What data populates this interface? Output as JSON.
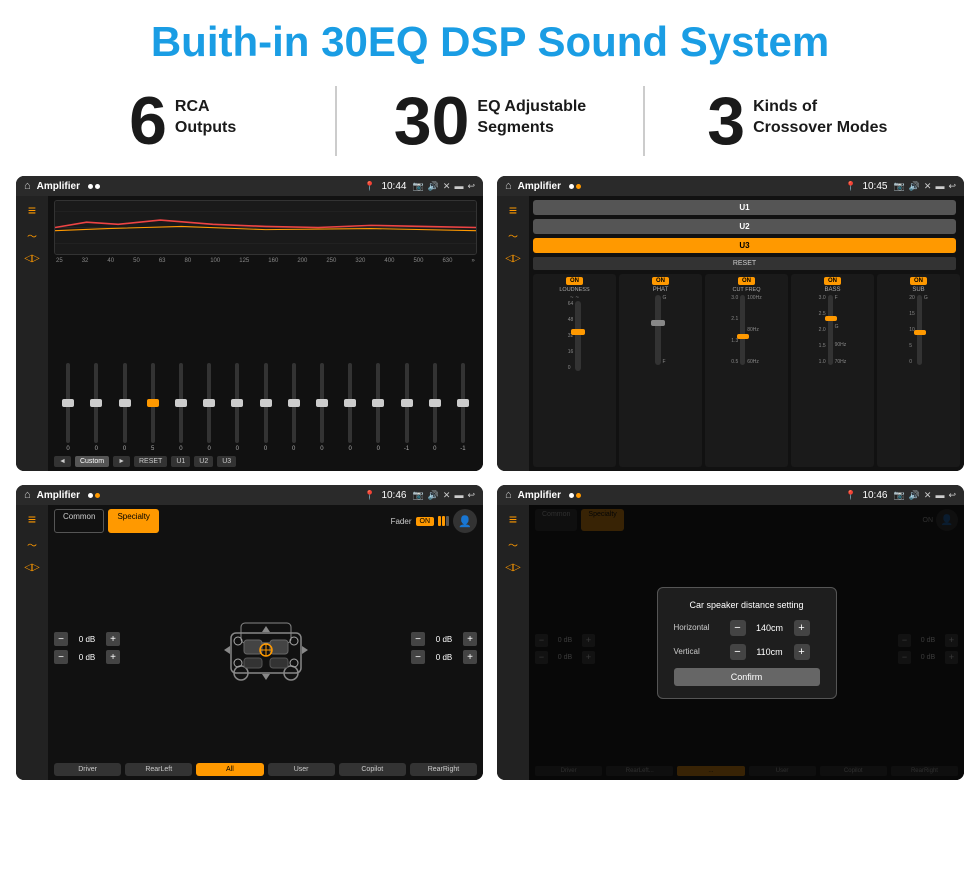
{
  "header": {
    "title": "Buith-in 30EQ DSP Sound System"
  },
  "stats": [
    {
      "number": "6",
      "label": "RCA\nOutputs"
    },
    {
      "number": "30",
      "label": "EQ Adjustable\nSegments"
    },
    {
      "number": "3",
      "label": "Kinds of\nCrossover Modes"
    }
  ],
  "screens": {
    "eq": {
      "title": "Amplifier",
      "time": "10:44",
      "freq_labels": [
        "25",
        "32",
        "40",
        "50",
        "63",
        "80",
        "100",
        "125",
        "160",
        "200",
        "250",
        "320",
        "400",
        "500",
        "630"
      ],
      "slider_values": [
        "0",
        "0",
        "0",
        "5",
        "0",
        "0",
        "0",
        "0",
        "0",
        "0",
        "0",
        "0",
        "-1",
        "0",
        "-1"
      ],
      "buttons": [
        "Custom",
        "RESET",
        "U1",
        "U2",
        "U3"
      ]
    },
    "amp": {
      "title": "Amplifier",
      "time": "10:45",
      "presets": [
        "U1",
        "U2",
        "U3"
      ],
      "channels": [
        {
          "label": "LOUDNESS",
          "on": true
        },
        {
          "label": "PHAT",
          "on": true
        },
        {
          "label": "CUT FREQ",
          "on": true
        },
        {
          "label": "BASS",
          "on": true
        },
        {
          "label": "SUB",
          "on": true
        }
      ],
      "reset_btn": "RESET"
    },
    "crossover": {
      "title": "Amplifier",
      "time": "10:46",
      "tabs": [
        "Common",
        "Specialty"
      ],
      "active_tab": "Specialty",
      "fader_label": "Fader",
      "fader_on": "ON",
      "db_values": [
        "0 dB",
        "0 dB",
        "0 dB",
        "0 dB"
      ],
      "bottom_buttons": [
        "Driver",
        "RearLeft",
        "All",
        "User",
        "Copilot",
        "RearRight"
      ]
    },
    "distance": {
      "title": "Amplifier",
      "time": "10:46",
      "modal": {
        "title": "Car speaker distance setting",
        "horizontal_label": "Horizontal",
        "horizontal_value": "140cm",
        "vertical_label": "Vertical",
        "vertical_value": "110cm",
        "confirm_btn": "Confirm"
      },
      "db_values": [
        "0 dB",
        "0 dB"
      ],
      "bottom_buttons": [
        "Driver",
        "RearLeft...",
        "...",
        "User",
        "Copilot",
        "RearRight"
      ]
    }
  }
}
